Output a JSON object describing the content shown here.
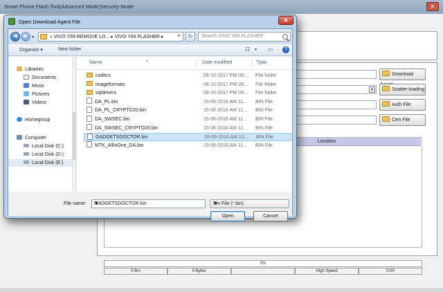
{
  "main_window": {
    "title": "Smart Phone Flash Tool(Advanced Mode)Security Mode",
    "close_label": "✕",
    "buttons": {
      "download_agent": "Download Agent",
      "scatter_loading": "Scatter-loading",
      "auth_file": "Auth File",
      "cert_file": "Cert File"
    },
    "table_header": {
      "location": "Location"
    },
    "status": {
      "progress_text": "0%",
      "cells": [
        "0 B/s",
        "0 Bytes",
        "",
        "High Speed",
        "0:00"
      ]
    }
  },
  "dialog": {
    "title": "Open Download Agent File",
    "close_label": "✕",
    "breadcrumb": [
      "«",
      "VIVO Y69 REMOVE LO...",
      "▸",
      "VIVO Y69 FLASHER",
      "▸"
    ],
    "search_placeholder": "Search VIVO Y69 FLASHER",
    "toolbar": {
      "organize": "Organize ▾",
      "new_folder": "New folder",
      "help": "?"
    },
    "nav_pane": [
      {
        "label": "Libraries",
        "icon": "libraries-icon"
      },
      {
        "label": "Documents",
        "icon": "documents-icon"
      },
      {
        "label": "Music",
        "icon": "music-icon"
      },
      {
        "label": "Pictures",
        "icon": "pictures-icon"
      },
      {
        "label": "Videos",
        "icon": "videos-icon"
      },
      {
        "label": "Homegroup",
        "icon": "homegroup-icon"
      },
      {
        "label": "Computer",
        "icon": "computer-icon"
      },
      {
        "label": "Local Disk (C:)",
        "icon": "drive-icon"
      },
      {
        "label": "Local Disk (D:)",
        "icon": "drive-icon"
      },
      {
        "label": "Local Disk (E:)",
        "icon": "drive-icon"
      }
    ],
    "columns": {
      "name": "Name",
      "date": "Date modified",
      "type": "Type"
    },
    "files": [
      {
        "name": "codecs",
        "date": "08-10-2017 PM 09:...",
        "type": "File folder",
        "kind": "folder"
      },
      {
        "name": "imageformats",
        "date": "08-10-2017 PM 09:...",
        "type": "File folder",
        "kind": "folder"
      },
      {
        "name": "sqldrivers",
        "date": "08-10-2017 PM 09:...",
        "type": "File folder",
        "kind": "folder"
      },
      {
        "name": "DA_PL.bin",
        "date": "15-06-2016 AM 11...",
        "type": "BIN File",
        "kind": "file"
      },
      {
        "name": "DA_PL_CRYPTO20.bin",
        "date": "15-06-2016 AM 11...",
        "type": "BIN File",
        "kind": "file"
      },
      {
        "name": "DA_SWSEC.bin",
        "date": "15-06-2016 AM 11...",
        "type": "BIN File",
        "kind": "file"
      },
      {
        "name": "DA_SWSEC_CRYPTO20.bin",
        "date": "15-06-2016 AM 11...",
        "type": "BIN File",
        "kind": "file"
      },
      {
        "name": "GADGETSDOCTOR.bin",
        "date": "26-09-2016 AM 10...",
        "type": "BIN File",
        "kind": "file",
        "selected": true
      },
      {
        "name": "MTK_AllInOne_DA.bin",
        "date": "15-06-2016 AM 11...",
        "type": "BIN File",
        "kind": "file"
      }
    ],
    "file_name_label": "File name:",
    "file_name_value": "GADGETSDOCTOR.bin",
    "file_type_value": "Bin File (*.bin)",
    "open_label": "Open",
    "cancel_label": "Cancel"
  }
}
